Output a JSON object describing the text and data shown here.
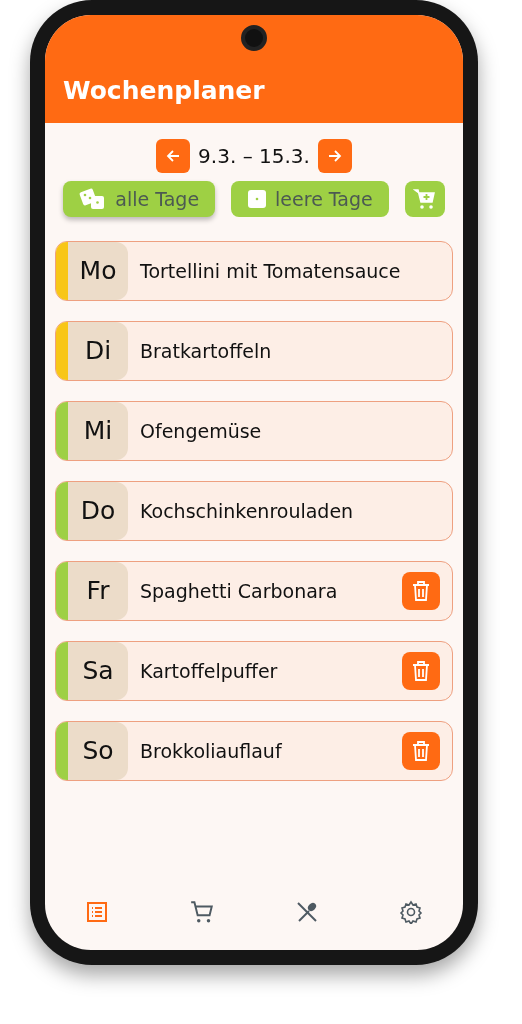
{
  "app_bar": {
    "title": "Wochenplaner"
  },
  "week": {
    "range": "9.3. – 15.3."
  },
  "actions": [
    {
      "kind": "dice",
      "label": "alle Tage"
    },
    {
      "kind": "die",
      "label": "leere Tage"
    },
    {
      "kind": "cart"
    }
  ],
  "days": [
    {
      "day": "Mo",
      "meal": "Tortellini mit Tomatensauce",
      "color": "#f8c617",
      "deletable": false
    },
    {
      "day": "Di",
      "meal": "Bratkartoffeln",
      "color": "#f8c617",
      "deletable": false
    },
    {
      "day": "Mi",
      "meal": "Ofengemüse",
      "color": "#9ed044",
      "deletable": false
    },
    {
      "day": "Do",
      "meal": "Kochschinkenrouladen",
      "color": "#9ed044",
      "deletable": false
    },
    {
      "day": "Fr",
      "meal": "Spaghetti Carbonara",
      "color": "#9ed044",
      "deletable": true
    },
    {
      "day": "Sa",
      "meal": "Kartoffelpuffer",
      "color": "#9ed044",
      "deletable": true
    },
    {
      "day": "So",
      "meal": "Brokkoliauflauf",
      "color": "#9ed044",
      "deletable": true
    }
  ],
  "nav": [
    {
      "kind": "list",
      "selected": true
    },
    {
      "kind": "cart",
      "selected": false
    },
    {
      "kind": "cutlery",
      "selected": false
    },
    {
      "kind": "settings",
      "selected": false
    }
  ]
}
